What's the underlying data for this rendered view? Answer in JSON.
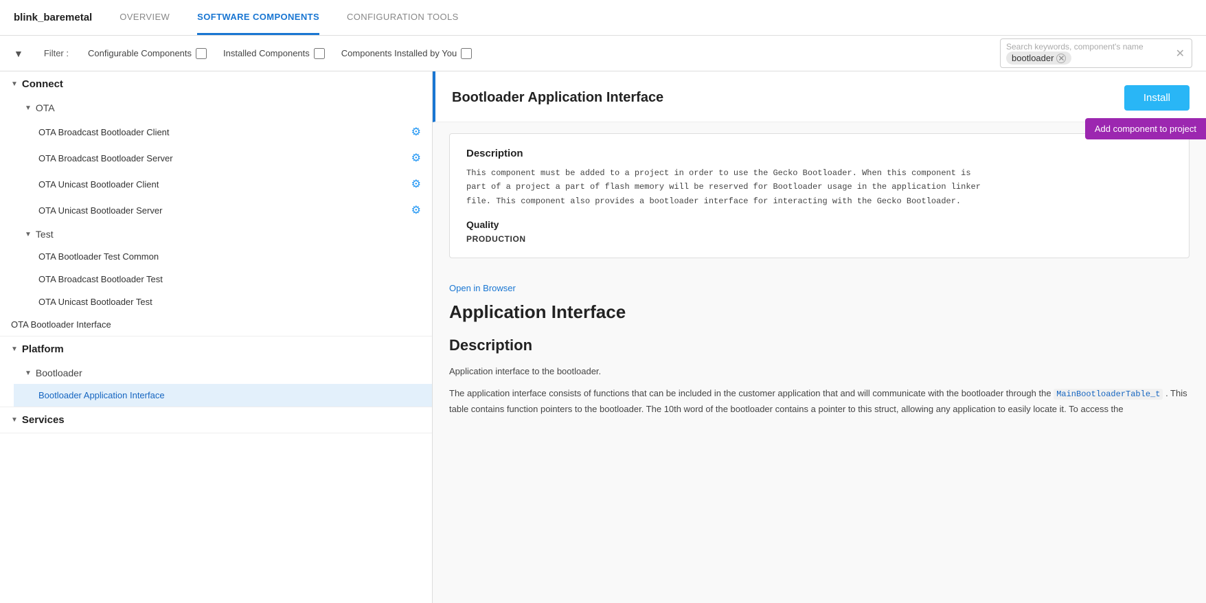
{
  "header": {
    "app_title": "blink_baremetal",
    "tabs": [
      {
        "id": "overview",
        "label": "OVERVIEW",
        "active": false
      },
      {
        "id": "software-components",
        "label": "SOFTWARE COMPONENTS",
        "active": true
      },
      {
        "id": "configuration-tools",
        "label": "CONFIGURATION TOOLS",
        "active": false
      }
    ]
  },
  "filter_bar": {
    "filter_label": "Filter :",
    "items": [
      {
        "id": "configurable",
        "label": "Configurable Components",
        "checked": false
      },
      {
        "id": "installed",
        "label": "Installed Components",
        "checked": false
      },
      {
        "id": "installed-by-you",
        "label": "Components Installed by You",
        "checked": false
      }
    ],
    "search": {
      "placeholder": "Search keywords, component's name",
      "value": "bootloader"
    }
  },
  "sidebar": {
    "sections": [
      {
        "id": "connect",
        "label": "Connect",
        "expanded": true,
        "subsections": [
          {
            "id": "ota",
            "label": "OTA",
            "expanded": true,
            "items": [
              {
                "id": "ota-broadcast-client",
                "label": "OTA Broadcast Bootloader Client",
                "has_gear": true
              },
              {
                "id": "ota-broadcast-server",
                "label": "OTA Broadcast Bootloader Server",
                "has_gear": true
              },
              {
                "id": "ota-unicast-client",
                "label": "OTA Unicast Bootloader Client",
                "has_gear": true
              },
              {
                "id": "ota-unicast-server",
                "label": "OTA Unicast Bootloader Server",
                "has_gear": true
              }
            ]
          },
          {
            "id": "test",
            "label": "Test",
            "expanded": true,
            "items": [
              {
                "id": "ota-bootloader-test-common",
                "label": "OTA Bootloader Test Common",
                "has_gear": false
              },
              {
                "id": "ota-broadcast-bootloader-test",
                "label": "OTA Broadcast Bootloader Test",
                "has_gear": false
              },
              {
                "id": "ota-unicast-bootloader-test",
                "label": "OTA Unicast Bootloader Test",
                "has_gear": false
              }
            ]
          },
          {
            "id": "ota-bootloader-interface",
            "label": "OTA Bootloader Interface",
            "is_direct": true,
            "has_gear": false
          }
        ]
      },
      {
        "id": "platform",
        "label": "Platform",
        "expanded": true,
        "subsections": [
          {
            "id": "bootloader",
            "label": "Bootloader",
            "expanded": true,
            "items": [
              {
                "id": "bootloader-application-interface",
                "label": "Bootloader Application Interface",
                "has_gear": false,
                "active": true
              }
            ]
          }
        ]
      },
      {
        "id": "services",
        "label": "Services",
        "expanded": false,
        "subsections": []
      }
    ]
  },
  "detail": {
    "title": "Bootloader Application Interface",
    "install_button": "Install",
    "add_component_button": "Add component to project",
    "description_heading": "Description",
    "description_text": "This component must be added to a project in order to use the Gecko Bootloader. When this component is\npart of a project a part of flash memory will be reserved for Bootloader usage in the application linker\nfile. This component also provides a bootloader interface for interacting with the Gecko Bootloader.",
    "quality_heading": "Quality",
    "quality_value": "PRODUCTION",
    "open_in_browser": "Open in Browser",
    "content_title": "Application Interface",
    "content_section_title": "Description",
    "content_text_1": "Application interface to the bootloader.",
    "content_text_2": "The application interface consists of functions that can be included in the customer application that and will communicate with the bootloader through the",
    "content_code": "MainBootloaderTable_t",
    "content_text_3": ". This table contains function pointers to the bootloader. The 10th word of the bootloader contains a pointer to this struct, allowing any application to easily locate it. To access the"
  },
  "colors": {
    "active_tab_border": "#1976d2",
    "install_btn_bg": "#29b6f6",
    "add_component_btn_bg": "#9c27b0",
    "gear_color": "#2196F3",
    "active_sidebar_item_bg": "#e3f0fb",
    "active_sidebar_item_color": "#1565c0",
    "detail_border_left": "#1976d2"
  }
}
